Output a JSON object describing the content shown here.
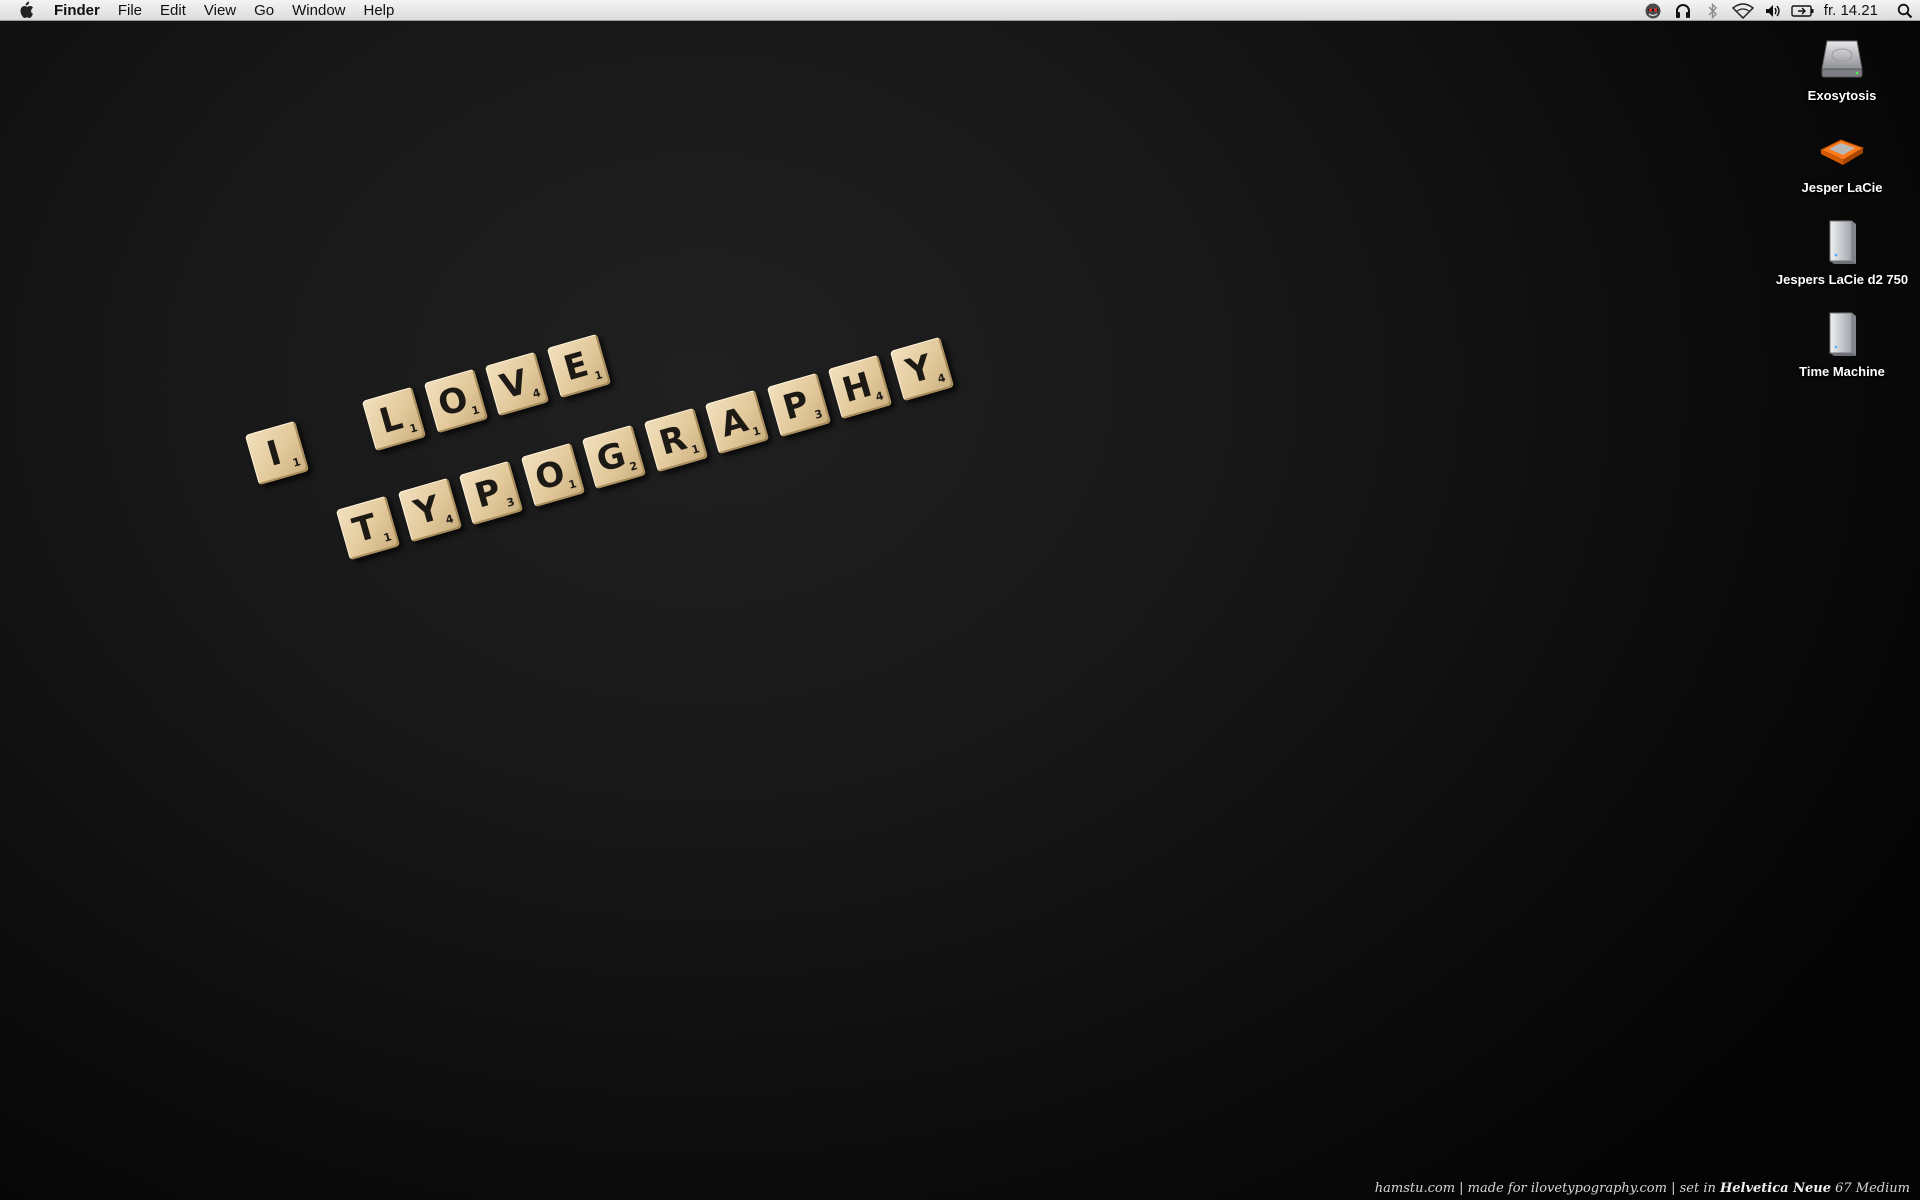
{
  "menubar": {
    "app_name": "Finder",
    "menus": [
      "File",
      "Edit",
      "View",
      "Go",
      "Window",
      "Help"
    ],
    "status_icons": [
      "spy-icon",
      "headphones-icon",
      "bluetooth-icon",
      "wifi-icon",
      "volume-icon",
      "battery-icon"
    ],
    "clock": "fr. 14.21"
  },
  "desktop": {
    "icons": [
      {
        "label": "Exosytosis",
        "icon": "hard-drive-icon"
      },
      {
        "label": "Jesper LaCie",
        "icon": "external-drive-icon"
      },
      {
        "label": "Jespers LaCie d2 750",
        "icon": "drive-tower-icon"
      },
      {
        "label": "Time Machine",
        "icon": "drive-tower-icon"
      }
    ]
  },
  "wallpaper": {
    "words": [
      {
        "tiles": [
          {
            "letter": "I",
            "points": "1"
          }
        ]
      },
      {
        "tiles": [
          {
            "letter": "L",
            "points": "1"
          },
          {
            "letter": "O",
            "points": "1"
          },
          {
            "letter": "V",
            "points": "4"
          },
          {
            "letter": "E",
            "points": "1"
          }
        ]
      },
      {
        "tiles": [
          {
            "letter": "T",
            "points": "1"
          },
          {
            "letter": "Y",
            "points": "4"
          },
          {
            "letter": "P",
            "points": "3"
          },
          {
            "letter": "O",
            "points": "1"
          },
          {
            "letter": "G",
            "points": "2"
          },
          {
            "letter": "R",
            "points": "1"
          },
          {
            "letter": "A",
            "points": "1"
          },
          {
            "letter": "P",
            "points": "3"
          },
          {
            "letter": "H",
            "points": "4"
          },
          {
            "letter": "Y",
            "points": "4"
          }
        ]
      }
    ],
    "credit": {
      "plain": "hamstu.com | made for ilovetypography.com | set in ",
      "bold": "Helvetica Neue",
      "tail": " 67 Medium"
    }
  }
}
